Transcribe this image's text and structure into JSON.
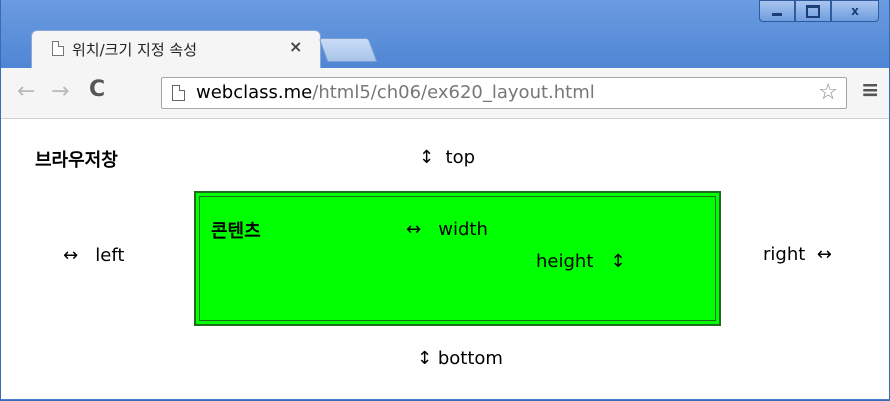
{
  "window": {
    "controls": {
      "minimize": "minimize",
      "maximize": "maximize",
      "close": "x"
    }
  },
  "tab": {
    "title": "위치/크기 지정 속성",
    "close": "×"
  },
  "toolbar": {
    "back": "←",
    "forward": "→",
    "reload": "C",
    "url_host": "webclass.me",
    "url_path": "/html5/ch06/ex620_layout.html",
    "star": "☆",
    "menu": "≡"
  },
  "page": {
    "browser_label": "브라우저창",
    "top_arrow": "↕",
    "top_label": "top",
    "left_arrow": "↔",
    "left_label": "left",
    "right_label": "right",
    "right_arrow": "↔",
    "bottom_arrow": "↕",
    "bottom_label": "bottom",
    "content_label": "콘텐츠",
    "width_arrow": "↔",
    "width_label": "width",
    "height_label": "height",
    "height_arrow": "↕"
  },
  "colors": {
    "content_fill": "#00ff00",
    "content_border": "#1e6d1e",
    "titlebar": "#4f86d4"
  }
}
